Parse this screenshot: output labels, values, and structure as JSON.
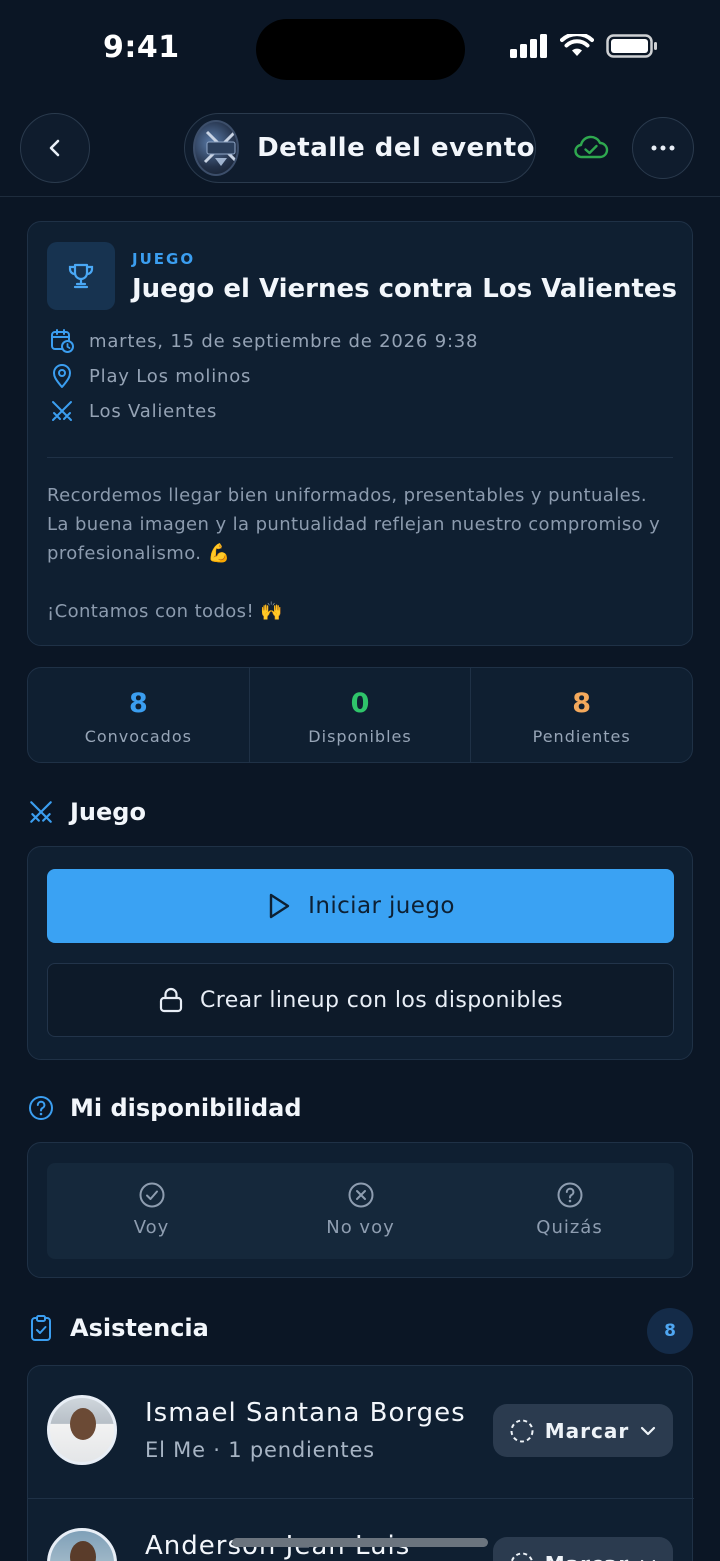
{
  "status": {
    "time": "9:41"
  },
  "header": {
    "title": "Detalle del evento",
    "back_icon": "chevron-left-icon",
    "sync_icon": "cloud-check-icon",
    "more_icon": "more-horizontal-icon"
  },
  "event": {
    "type": "JUEGO",
    "title": "Juego el Viernes contra Los Valientes",
    "datetime": "martes, 15 de septiembre de 2026 9:38",
    "location": "Play Los molinos",
    "opponent": "Los Valientes",
    "description": [
      "Recordemos llegar bien uniformados, presentables y puntuales. La buena imagen y la puntualidad reflejan nuestro compromiso y profesionalismo. 💪",
      "¡Contamos con todos! 🙌"
    ]
  },
  "stats": [
    {
      "value": "8",
      "label": "Convocados",
      "color": "#3b9ef0"
    },
    {
      "value": "0",
      "label": "Disponibles",
      "color": "#2fc46a"
    },
    {
      "value": "8",
      "label": "Pendientes",
      "color": "#f4a95c"
    }
  ],
  "game_section": {
    "title": "Juego",
    "start_label": "Iniciar juego",
    "lineup_label": "Crear lineup con los disponibles"
  },
  "availability_section": {
    "title": "Mi disponibilidad",
    "options": [
      {
        "label": "Voy",
        "icon": "check-circle-icon"
      },
      {
        "label": "No voy",
        "icon": "x-circle-icon"
      },
      {
        "label": "Quizás",
        "icon": "question-circle-icon"
      }
    ]
  },
  "attendance_section": {
    "title": "Asistencia",
    "count": "8",
    "players": [
      {
        "name": "Ismael Santana Borges",
        "sub": "El Me · 1 pendientes",
        "action": "Marcar"
      },
      {
        "name": "Anderson Jean Luis",
        "sub": "",
        "action": "Marcar"
      }
    ]
  },
  "colors": {
    "background": "#0b1625",
    "card": "#0f1f31",
    "accent": "#3aa2f3",
    "success": "#2fc46a",
    "warning": "#f4a95c"
  }
}
